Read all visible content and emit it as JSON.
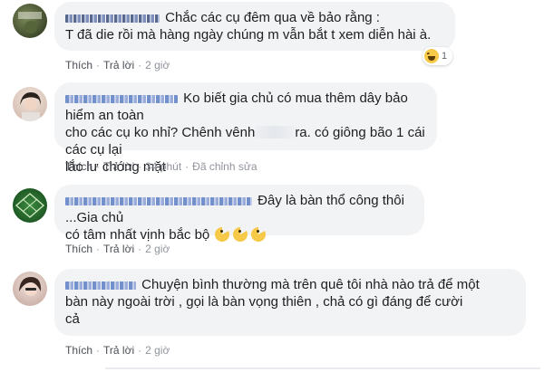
{
  "comments": [
    {
      "text_line1": "Chắc các cụ đêm qua về bảo rằng :",
      "text_line2": "T đã die rồi mà hàng ngày chúng m vẫn bắt t xem diễn hài à.",
      "actions": {
        "like": "Thích",
        "reply": "Trả lời",
        "time": "2 giờ"
      },
      "reaction": {
        "icon": "haha-emoji-icon",
        "count": "1"
      }
    },
    {
      "text_line1": "Ko biết gia chủ có mua thêm dây bảo hiểm an toàn",
      "text_line2a": "cho các cụ ko nhỉ? Chênh vênh",
      "text_line2b": "ra. có giông bão 1 cái các cụ lại",
      "text_line3": "lắc lư chóng mặt",
      "actions": {
        "like": "Thích",
        "reply": "Trả lời",
        "time": "34 phút",
        "edited": "Đã chỉnh sửa"
      }
    },
    {
      "text_line1": "Đây là bàn thổ công thôi ...Gia chủ",
      "text_line2": "có tâm nhất vịnh bắc bộ",
      "actions": {
        "like": "Thích",
        "reply": "Trả lời",
        "time": "2 giờ"
      }
    },
    {
      "text_line1": "Chuyện bình thường mà trên quê tôi nhà nào trả để một",
      "text_line2": "bàn này ngoài trời , gọi là bàn vọng thiên , chả có gì đáng để cười",
      "text_line3": "cả",
      "actions": {
        "like": "Thích",
        "reply": "Trả lời",
        "time": "2 giờ"
      }
    }
  ],
  "separator": "·",
  "colors": {
    "bubble": "#f2f3f5",
    "action_text": "#4b4f56",
    "meta_text": "#90949c"
  }
}
